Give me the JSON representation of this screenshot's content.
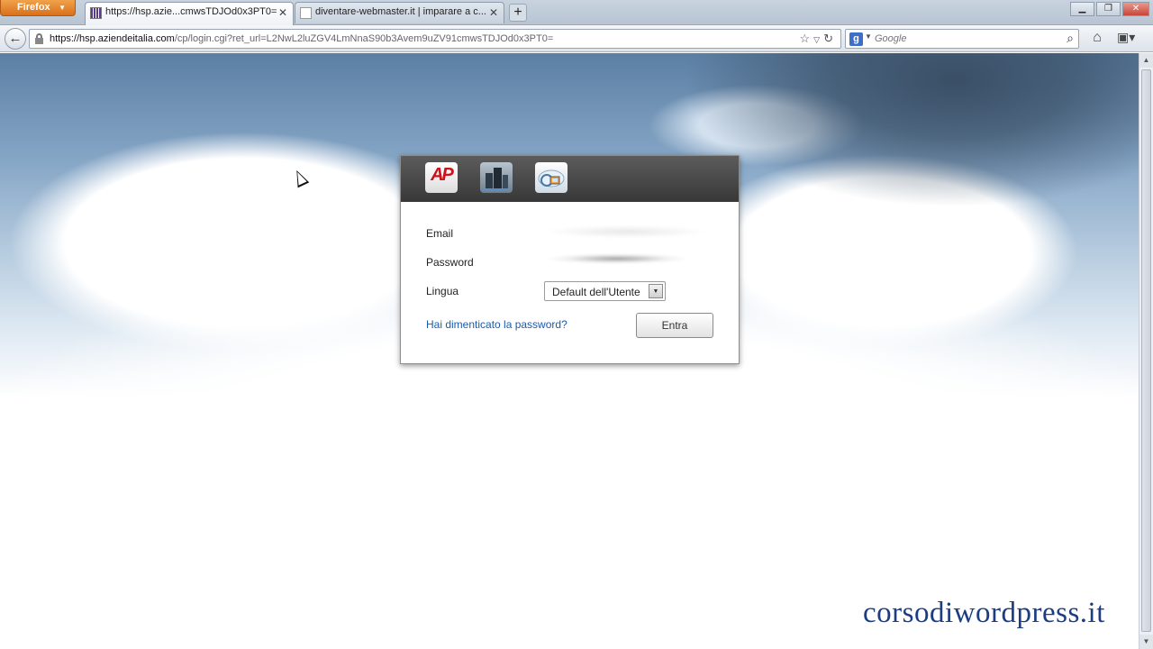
{
  "browser": {
    "menu_label": "Firefox",
    "tabs": [
      {
        "title": "https://hsp.azie...cmwsTDJOd0x3PT0=",
        "active": true,
        "favicon": "bars-favicon"
      },
      {
        "title": "diventare-webmaster.it | imparare a c...",
        "active": false,
        "favicon": "page-favicon"
      }
    ],
    "new_tab_label": "+",
    "url_domain": "https://hsp.aziendeitalia.com",
    "url_path": "/cp/login.cgi?ret_url=L2NwL2luZGV4LmNnaS90b3Avem9uZV91cmwsTDJOd0x3PT0=",
    "search_placeholder": "Google"
  },
  "login": {
    "icons": [
      "ap-logo-icon",
      "buildings-icon",
      "cloud-computer-icon"
    ],
    "ap_text": "AP",
    "email_label": "Email",
    "password_label": "Password",
    "language_label": "Lingua",
    "language_value": "Default dell'Utente",
    "forgot_link": "Hai dimenticato la password?",
    "submit_label": "Entra"
  },
  "watermark": "corsodiwordpress.it"
}
